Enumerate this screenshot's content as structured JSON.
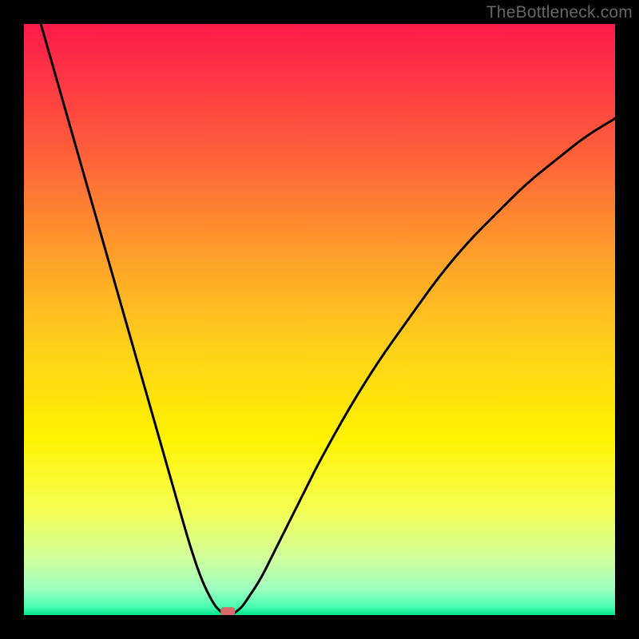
{
  "watermark": "TheBottleneck.com",
  "chart_data": {
    "type": "line",
    "title": "",
    "xlabel": "",
    "ylabel": "",
    "xlim": [
      0,
      100
    ],
    "ylim": [
      0,
      100
    ],
    "series": [
      {
        "name": "curve",
        "x": [
          0,
          2,
          4,
          6,
          8,
          10,
          12,
          14,
          16,
          18,
          20,
          22,
          24,
          26,
          28,
          30,
          32,
          33,
          34,
          35,
          36,
          37,
          38,
          40,
          42,
          44,
          46,
          48,
          50,
          55,
          60,
          65,
          70,
          75,
          80,
          85,
          90,
          95,
          100
        ],
        "y": [
          110,
          103,
          96,
          89,
          82,
          75,
          68,
          61,
          54,
          47,
          40,
          33,
          26,
          19,
          12,
          6,
          2,
          0.8,
          0,
          0,
          0.6,
          1.5,
          3,
          6,
          10,
          14,
          18,
          22,
          26,
          35,
          43,
          50,
          57,
          63,
          68,
          73,
          77,
          81,
          84
        ]
      }
    ],
    "gradient_stops": [
      {
        "offset": 0.0,
        "color": "#ff1a4b"
      },
      {
        "offset": 0.1,
        "color": "#ff3944"
      },
      {
        "offset": 0.25,
        "color": "#ff6a37"
      },
      {
        "offset": 0.4,
        "color": "#ffa229"
      },
      {
        "offset": 0.55,
        "color": "#ffd21a"
      },
      {
        "offset": 0.7,
        "color": "#fff200"
      },
      {
        "offset": 0.82,
        "color": "#f6ff52"
      },
      {
        "offset": 0.9,
        "color": "#d2ff9a"
      },
      {
        "offset": 0.955,
        "color": "#a0ffc0"
      },
      {
        "offset": 0.985,
        "color": "#4cffb0"
      },
      {
        "offset": 1.0,
        "color": "#00e68a"
      }
    ],
    "marker": {
      "x": 34.5,
      "y": 0.6,
      "color": "#d86b6b"
    }
  }
}
